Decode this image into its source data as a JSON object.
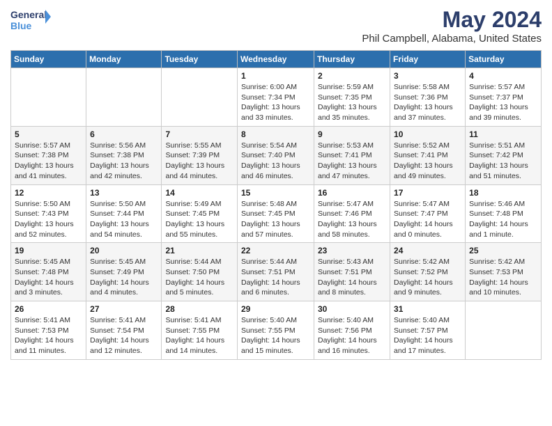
{
  "logo": {
    "line1": "General",
    "line2": "Blue"
  },
  "title": "May 2024",
  "subtitle": "Phil Campbell, Alabama, United States",
  "days_header": [
    "Sunday",
    "Monday",
    "Tuesday",
    "Wednesday",
    "Thursday",
    "Friday",
    "Saturday"
  ],
  "weeks": [
    [
      {
        "day": "",
        "info": ""
      },
      {
        "day": "",
        "info": ""
      },
      {
        "day": "",
        "info": ""
      },
      {
        "day": "1",
        "info": "Sunrise: 6:00 AM\nSunset: 7:34 PM\nDaylight: 13 hours\nand 33 minutes."
      },
      {
        "day": "2",
        "info": "Sunrise: 5:59 AM\nSunset: 7:35 PM\nDaylight: 13 hours\nand 35 minutes."
      },
      {
        "day": "3",
        "info": "Sunrise: 5:58 AM\nSunset: 7:36 PM\nDaylight: 13 hours\nand 37 minutes."
      },
      {
        "day": "4",
        "info": "Sunrise: 5:57 AM\nSunset: 7:37 PM\nDaylight: 13 hours\nand 39 minutes."
      }
    ],
    [
      {
        "day": "5",
        "info": "Sunrise: 5:57 AM\nSunset: 7:38 PM\nDaylight: 13 hours\nand 41 minutes."
      },
      {
        "day": "6",
        "info": "Sunrise: 5:56 AM\nSunset: 7:38 PM\nDaylight: 13 hours\nand 42 minutes."
      },
      {
        "day": "7",
        "info": "Sunrise: 5:55 AM\nSunset: 7:39 PM\nDaylight: 13 hours\nand 44 minutes."
      },
      {
        "day": "8",
        "info": "Sunrise: 5:54 AM\nSunset: 7:40 PM\nDaylight: 13 hours\nand 46 minutes."
      },
      {
        "day": "9",
        "info": "Sunrise: 5:53 AM\nSunset: 7:41 PM\nDaylight: 13 hours\nand 47 minutes."
      },
      {
        "day": "10",
        "info": "Sunrise: 5:52 AM\nSunset: 7:41 PM\nDaylight: 13 hours\nand 49 minutes."
      },
      {
        "day": "11",
        "info": "Sunrise: 5:51 AM\nSunset: 7:42 PM\nDaylight: 13 hours\nand 51 minutes."
      }
    ],
    [
      {
        "day": "12",
        "info": "Sunrise: 5:50 AM\nSunset: 7:43 PM\nDaylight: 13 hours\nand 52 minutes."
      },
      {
        "day": "13",
        "info": "Sunrise: 5:50 AM\nSunset: 7:44 PM\nDaylight: 13 hours\nand 54 minutes."
      },
      {
        "day": "14",
        "info": "Sunrise: 5:49 AM\nSunset: 7:45 PM\nDaylight: 13 hours\nand 55 minutes."
      },
      {
        "day": "15",
        "info": "Sunrise: 5:48 AM\nSunset: 7:45 PM\nDaylight: 13 hours\nand 57 minutes."
      },
      {
        "day": "16",
        "info": "Sunrise: 5:47 AM\nSunset: 7:46 PM\nDaylight: 13 hours\nand 58 minutes."
      },
      {
        "day": "17",
        "info": "Sunrise: 5:47 AM\nSunset: 7:47 PM\nDaylight: 14 hours\nand 0 minutes."
      },
      {
        "day": "18",
        "info": "Sunrise: 5:46 AM\nSunset: 7:48 PM\nDaylight: 14 hours\nand 1 minute."
      }
    ],
    [
      {
        "day": "19",
        "info": "Sunrise: 5:45 AM\nSunset: 7:48 PM\nDaylight: 14 hours\nand 3 minutes."
      },
      {
        "day": "20",
        "info": "Sunrise: 5:45 AM\nSunset: 7:49 PM\nDaylight: 14 hours\nand 4 minutes."
      },
      {
        "day": "21",
        "info": "Sunrise: 5:44 AM\nSunset: 7:50 PM\nDaylight: 14 hours\nand 5 minutes."
      },
      {
        "day": "22",
        "info": "Sunrise: 5:44 AM\nSunset: 7:51 PM\nDaylight: 14 hours\nand 6 minutes."
      },
      {
        "day": "23",
        "info": "Sunrise: 5:43 AM\nSunset: 7:51 PM\nDaylight: 14 hours\nand 8 minutes."
      },
      {
        "day": "24",
        "info": "Sunrise: 5:42 AM\nSunset: 7:52 PM\nDaylight: 14 hours\nand 9 minutes."
      },
      {
        "day": "25",
        "info": "Sunrise: 5:42 AM\nSunset: 7:53 PM\nDaylight: 14 hours\nand 10 minutes."
      }
    ],
    [
      {
        "day": "26",
        "info": "Sunrise: 5:41 AM\nSunset: 7:53 PM\nDaylight: 14 hours\nand 11 minutes."
      },
      {
        "day": "27",
        "info": "Sunrise: 5:41 AM\nSunset: 7:54 PM\nDaylight: 14 hours\nand 12 minutes."
      },
      {
        "day": "28",
        "info": "Sunrise: 5:41 AM\nSunset: 7:55 PM\nDaylight: 14 hours\nand 14 minutes."
      },
      {
        "day": "29",
        "info": "Sunrise: 5:40 AM\nSunset: 7:55 PM\nDaylight: 14 hours\nand 15 minutes."
      },
      {
        "day": "30",
        "info": "Sunrise: 5:40 AM\nSunset: 7:56 PM\nDaylight: 14 hours\nand 16 minutes."
      },
      {
        "day": "31",
        "info": "Sunrise: 5:40 AM\nSunset: 7:57 PM\nDaylight: 14 hours\nand 17 minutes."
      },
      {
        "day": "",
        "info": ""
      }
    ]
  ]
}
